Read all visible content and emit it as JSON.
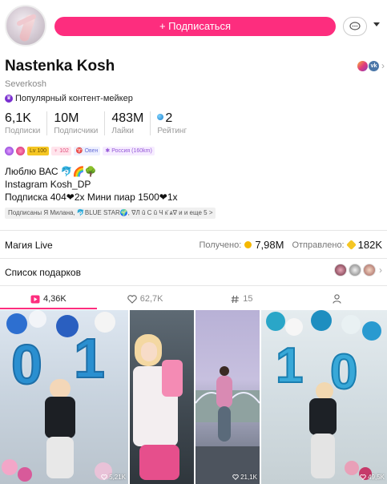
{
  "header": {
    "subscribe_label": "+ Подписаться"
  },
  "profile": {
    "name": "Nastenka Kosh",
    "username": "Severkosh",
    "popular_label": "Популярный контент-мейкер",
    "social_more": "›"
  },
  "stats": [
    {
      "value": "6,1K",
      "label": "Подписки"
    },
    {
      "value": "10M",
      "label": "Подписчики"
    },
    {
      "value": "483M",
      "label": "Лайки"
    },
    {
      "value": "2",
      "label": "Рейтинг"
    }
  ],
  "tags": {
    "level": "Lv 100",
    "count": "♀ 102",
    "zodiac": "♈ Овен",
    "location": "✱ Россия (160km)"
  },
  "bio": {
    "line1": "Люблю ВАС 🐬🌈🌳",
    "line2": "Instagram Kosh_DP",
    "line3": "Подписка 404❤2х Мини пиар 1500❤1х"
  },
  "followed_by": "Подписаны Я Милана, 🐬BLUE STAR🌍, ∇Л û С û Ч к̈ ѧ∇ и и еще 5 >",
  "magic": {
    "label": "Магия Live",
    "received_label": "Получено:",
    "received_value": "7,98M",
    "sent_label": "Отправлено:",
    "sent_value": "182K"
  },
  "gifts": {
    "label": "Список подарков",
    "more": "›"
  },
  "tabs": [
    {
      "label": "4,36K",
      "icon": "video-icon"
    },
    {
      "label": "62,7K",
      "icon": "heart-icon"
    },
    {
      "label": "15",
      "icon": "hashtag-icon"
    },
    {
      "label": "",
      "icon": "person-icon"
    }
  ],
  "videos": [
    {
      "views": "5,21K"
    },
    {
      "views": ""
    },
    {
      "views": "21,1K"
    },
    {
      "views": "49,5K"
    }
  ],
  "colors": {
    "accent": "#fd2d7e",
    "level_tag": "#f5c623",
    "coin_gold": "#f5b800"
  }
}
